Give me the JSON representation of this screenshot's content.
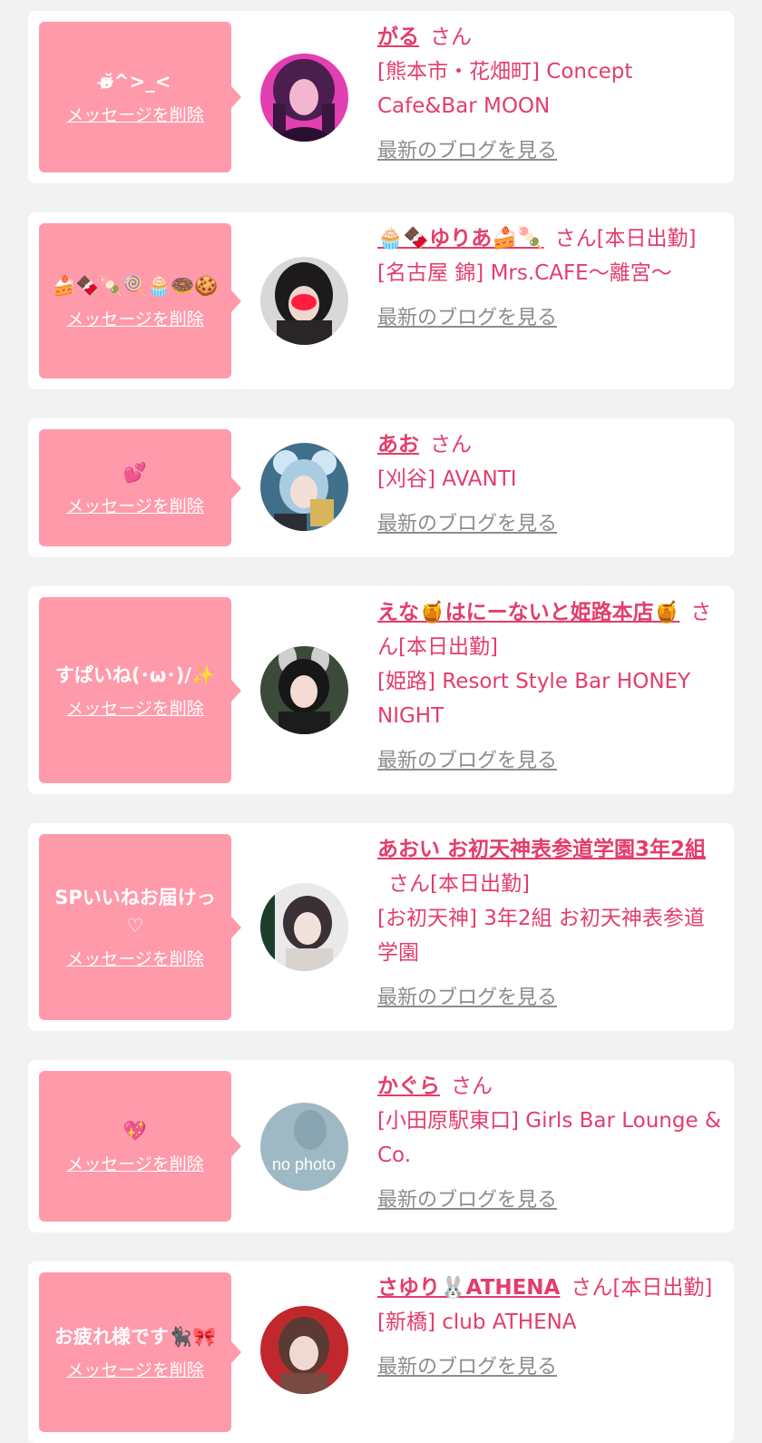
{
  "delete_label": "メッセージを削除",
  "blog_label": "最新のブログを見る",
  "san_label": "さん",
  "items": [
    {
      "message": "ʚ̴̶̷̆^>_<",
      "name": "がる",
      "san_suffix": "",
      "shop": "[熊本市・花畑町] Concept Cafe&Bar MOON"
    },
    {
      "message": "🍰🍫🍡🍭🧁🍩🍪",
      "name": "🧁🍫ゆりあ🍰🍡",
      "san_suffix": "[本日出勤]",
      "shop": "[名古屋 錦] Mrs.CAFE〜離宮〜"
    },
    {
      "message": "💕",
      "name": "あお",
      "san_suffix": "",
      "shop": "[刈谷] AVANTI"
    },
    {
      "message": "すぱいね(･ω･)/✨",
      "name": "えな🍯はにーないと姫路本店🍯",
      "san_suffix": "[本日出勤]",
      "shop": "[姫路] Resort Style Bar HONEY NIGHT"
    },
    {
      "message": "SPいいねお届けっ♡",
      "name": "あおい お初天神表参道学園3年2組",
      "san_suffix": "[本日出勤]",
      "shop": "[お初天神] 3年2組 お初天神表参道学園"
    },
    {
      "message": "💖",
      "name": "かぐら",
      "san_suffix": "",
      "shop": "[小田原駅東口] Girls Bar Lounge & Co."
    },
    {
      "message": "お疲れ様です🐈‍⬛🎀",
      "name": "さゆり🐰ATHENA",
      "san_suffix": "[本日出勤]",
      "shop": "[新橋] club ATHENA"
    }
  ],
  "avatar_placeholder_text": "no photo",
  "colors": {
    "accent": "#e33d6b",
    "bubble": "#ff9aab",
    "background": "#f2f2f2",
    "link_gray": "#8c8c8c"
  }
}
